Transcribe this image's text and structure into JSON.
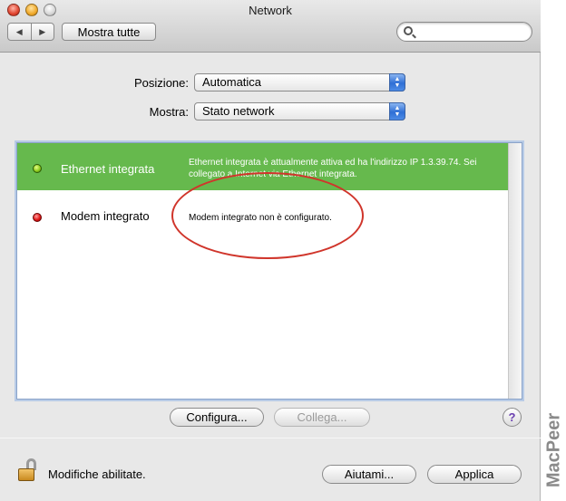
{
  "window": {
    "title": "Network"
  },
  "toolbar": {
    "back_glyph": "◀",
    "forward_glyph": "▶",
    "show_all_label": "Mostra tutte",
    "search_value": ""
  },
  "location": {
    "label": "Posizione:",
    "selected": "Automatica"
  },
  "show": {
    "label": "Mostra:",
    "selected": "Stato network"
  },
  "interfaces": [
    {
      "name": "Ethernet integrata",
      "status": "active",
      "status_color": "#66b94d",
      "description": "Ethernet integrata è attualmente attiva ed ha l'indirizzo IP 1.3.39.74. Sei collegato a Internet via Ethernet integrata."
    },
    {
      "name": "Modem integrato",
      "status": "inactive",
      "status_color": "#e01717",
      "description": "Modem integrato non è configurato."
    }
  ],
  "buttons": {
    "configure": "Configura...",
    "connect": "Collega...",
    "help": "?",
    "assist": "Aiutami...",
    "apply": "Applica"
  },
  "lock": {
    "message": "Modifiche abilitate."
  },
  "watermark": "MacPeer",
  "colors": {
    "accent_blue": "#2f6fd6",
    "annotation_red": "#d0352b"
  }
}
